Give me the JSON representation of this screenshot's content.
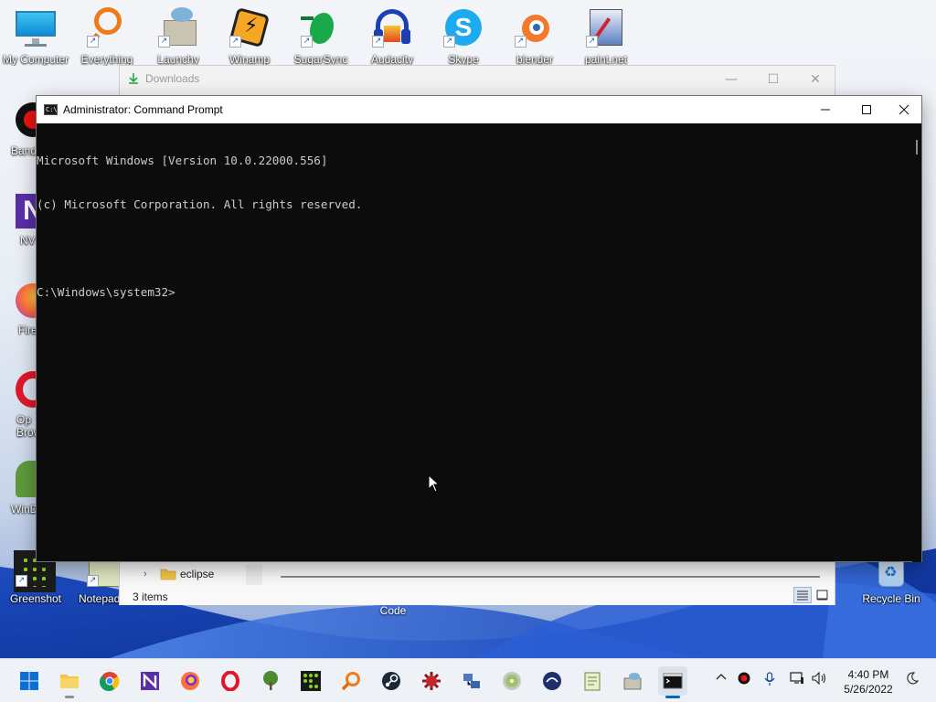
{
  "desktop": {
    "icons": [
      {
        "label": "My Computer",
        "icon": "monitor-icon"
      },
      {
        "label": "Everything",
        "icon": "magnifier-icon"
      },
      {
        "label": "Launchy",
        "icon": "launchy-icon"
      },
      {
        "label": "Winamp",
        "icon": "winamp-icon"
      },
      {
        "label": "SugarSync",
        "icon": "hummingbird-icon"
      },
      {
        "label": "Audacity",
        "icon": "headphones-icon"
      },
      {
        "label": "Skype",
        "icon": "skype-icon"
      },
      {
        "label": "blender",
        "icon": "blender-icon"
      },
      {
        "label": "paint.net",
        "icon": "paintnet-icon"
      }
    ],
    "left_icons": [
      {
        "label": "Band",
        "icon": "record-icon"
      },
      {
        "label": "NV",
        "icon": "nvda-icon"
      },
      {
        "label": "Fire",
        "icon": "firefox-icon"
      },
      {
        "label": "Op Brow",
        "icon": "opera-icon"
      },
      {
        "label": "WinD",
        "icon": "tree-icon"
      },
      {
        "label": "Greenshot",
        "icon": "greenshot-icon"
      },
      {
        "label": "Notepad",
        "icon": "notepad-icon"
      }
    ],
    "recycle_bin": "Recycle Bin",
    "code_label": "Code"
  },
  "downloads_window": {
    "title": "Downloads",
    "tree_item": "eclipse",
    "status": "3 items"
  },
  "cmd_window": {
    "title": "Administrator: Command Prompt",
    "console_lines": [
      "Microsoft Windows [Version 10.0.22000.556]",
      "(c) Microsoft Corporation. All rights reserved.",
      "",
      "C:\\Windows\\system32>"
    ]
  },
  "taskbar": {
    "apps": [
      "start",
      "file-explorer",
      "chrome",
      "nvda",
      "firefox",
      "opera",
      "windirstat",
      "greenshot",
      "everything",
      "steam",
      "app-red",
      "network-tool",
      "disk-tool",
      "app-blue",
      "notepad-plus",
      "launchy",
      "command-prompt"
    ],
    "clock_time": "4:40 PM",
    "clock_date": "5/26/2022"
  },
  "colors": {
    "console_bg": "#0c0c0c",
    "console_fg": "#cccccc",
    "accent": "#0067c0"
  }
}
